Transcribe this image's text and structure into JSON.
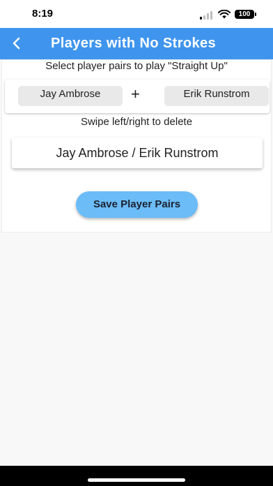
{
  "status_bar": {
    "time": "8:19",
    "battery": "100"
  },
  "header": {
    "title": "Players with No Strokes",
    "back_icon": "chevron-left-icon"
  },
  "main": {
    "instructions": "Select player pairs to play \"Straight Up\"",
    "player_one": "Jay Ambrose",
    "plus": "+",
    "player_two": "Erik Runstrom",
    "swipe_hint": "Swipe left/right to delete",
    "pairs": [
      "Jay Ambrose / Erik Runstrom"
    ],
    "save_label": "Save Player Pairs"
  },
  "colors": {
    "app_bar": "#3f95ee",
    "button": "#6bbcf7"
  }
}
